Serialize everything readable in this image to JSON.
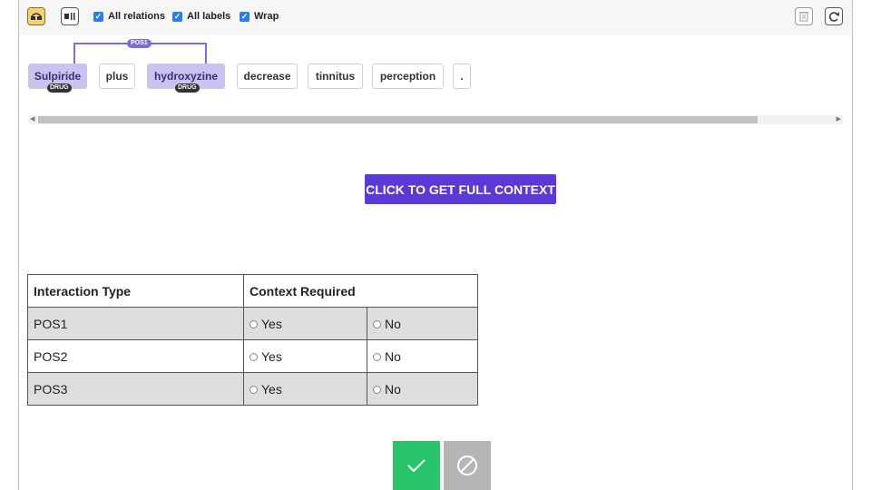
{
  "toolbar": {
    "relations_label": "All relations",
    "labels_label": "All labels",
    "wrap_label": "Wrap"
  },
  "sentence": {
    "tokens": [
      "Sulpiride",
      "plus",
      "hydroxyzine",
      "decrease",
      "tinnitus",
      "perception",
      "."
    ],
    "entity_label": "DRUG",
    "relation_label": "POS1"
  },
  "context_button": "CLICK TO GET FULL CONTEXT",
  "table": {
    "headers": [
      "Interaction Type",
      "Context Required"
    ],
    "rows": [
      {
        "type": "POS1",
        "yes": "Yes",
        "no": "No"
      },
      {
        "type": "POS2",
        "yes": "Yes",
        "no": "No"
      },
      {
        "type": "POS3",
        "yes": "Yes",
        "no": "No"
      }
    ]
  },
  "colors": {
    "accent": "#5a39d6",
    "entity": "#c9c3f0",
    "relation": "#7b6fd6",
    "accept": "#28c36b",
    "reject": "#b5b5b5"
  },
  "icons": {
    "accept": "check-icon",
    "reject": "prohibited-icon",
    "delete": "trash-icon",
    "reset": "refresh-icon"
  }
}
